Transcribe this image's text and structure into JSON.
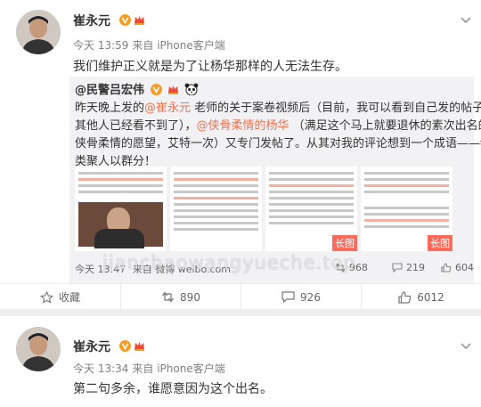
{
  "post1": {
    "username": "崔永元",
    "time": "今天 13:59",
    "source": "来自 iPhone客户端",
    "text": "我们维护正义就是为了让杨华那样的人无法生存。",
    "repost": {
      "author": "@民警吕宏伟",
      "lines": [
        [
          "昨天晚上发的",
          "@崔永元",
          " 老师的关于案卷视频后（目前，我可以看到自己发的帖子，"
        ],
        [
          "其他人已经看不到了），",
          "@侠骨柔情的杨华",
          " （满足这个马上就要退休的素次出名的"
        ],
        [
          "侠骨柔情的愿望，艾特一次）又专门发帖了。从其对我的评论想到一个成语——物以"
        ],
        [
          "类聚人以群分！"
        ]
      ],
      "thumb_badge": "长图",
      "stats": {
        "time": "今天 13:47",
        "source": "来自 微博 weibo.com",
        "reposts": "968",
        "comments": "219",
        "likes": "604"
      }
    },
    "actions": {
      "favorite": "收藏",
      "repost": "890",
      "comment": "926",
      "like": "6012"
    }
  },
  "post2": {
    "username": "崔永元",
    "time": "今天 13:34",
    "source": "来自 iPhone客户端",
    "text": "第二句多余，谁愿意因为这个出名。"
  },
  "watermark": "jianchaowangyueche.top",
  "colors": {
    "accent": "#eb7350",
    "badge_orange": "#f49d26",
    "badge_red": "#ec4a3e",
    "longimg": "#ff6b5a"
  }
}
